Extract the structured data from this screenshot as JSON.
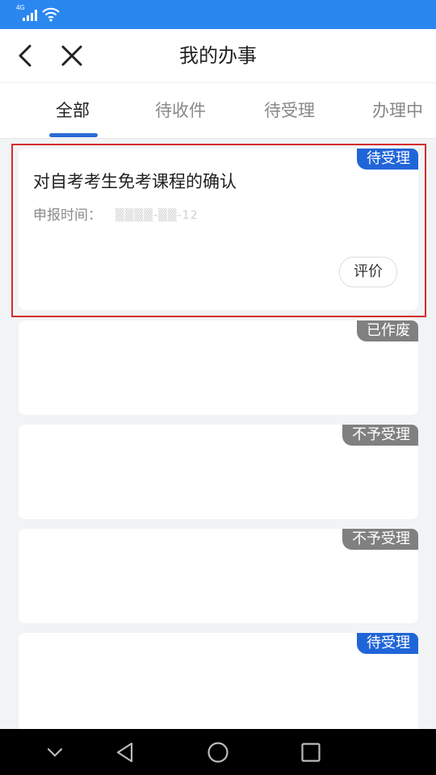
{
  "status_bar": {
    "network": "4G",
    "icons": [
      "signal-icon",
      "wifi-icon"
    ]
  },
  "nav": {
    "title": "我的办事",
    "icons": [
      "back-icon",
      "close-icon"
    ]
  },
  "tabs": [
    {
      "label": "全部",
      "active": true
    },
    {
      "label": "待收件",
      "active": false
    },
    {
      "label": "待受理",
      "active": false
    },
    {
      "label": "办理中",
      "active": false
    }
  ],
  "cards": [
    {
      "status": "待受理",
      "status_color": "#2065d8",
      "title": "对自考考生免考课程的确认",
      "date_label": "申报时间：",
      "date_value": "▒▒▒▒-▒▒-12",
      "action_label": "评价"
    },
    {
      "status": "已作废",
      "status_color": "#808080"
    },
    {
      "status": "不予受理",
      "status_color": "#808080"
    },
    {
      "status": "不予受理",
      "status_color": "#808080"
    },
    {
      "status": "待受理",
      "status_color": "#2065d8"
    }
  ],
  "system_nav": {
    "icons": [
      "collapse-icon",
      "back-triangle-icon",
      "home-circle-icon",
      "recents-square-icon"
    ]
  },
  "colors": {
    "status_bar": "#2b87f0",
    "accent": "#2b6cd6",
    "highlight": "#d42d2d"
  }
}
